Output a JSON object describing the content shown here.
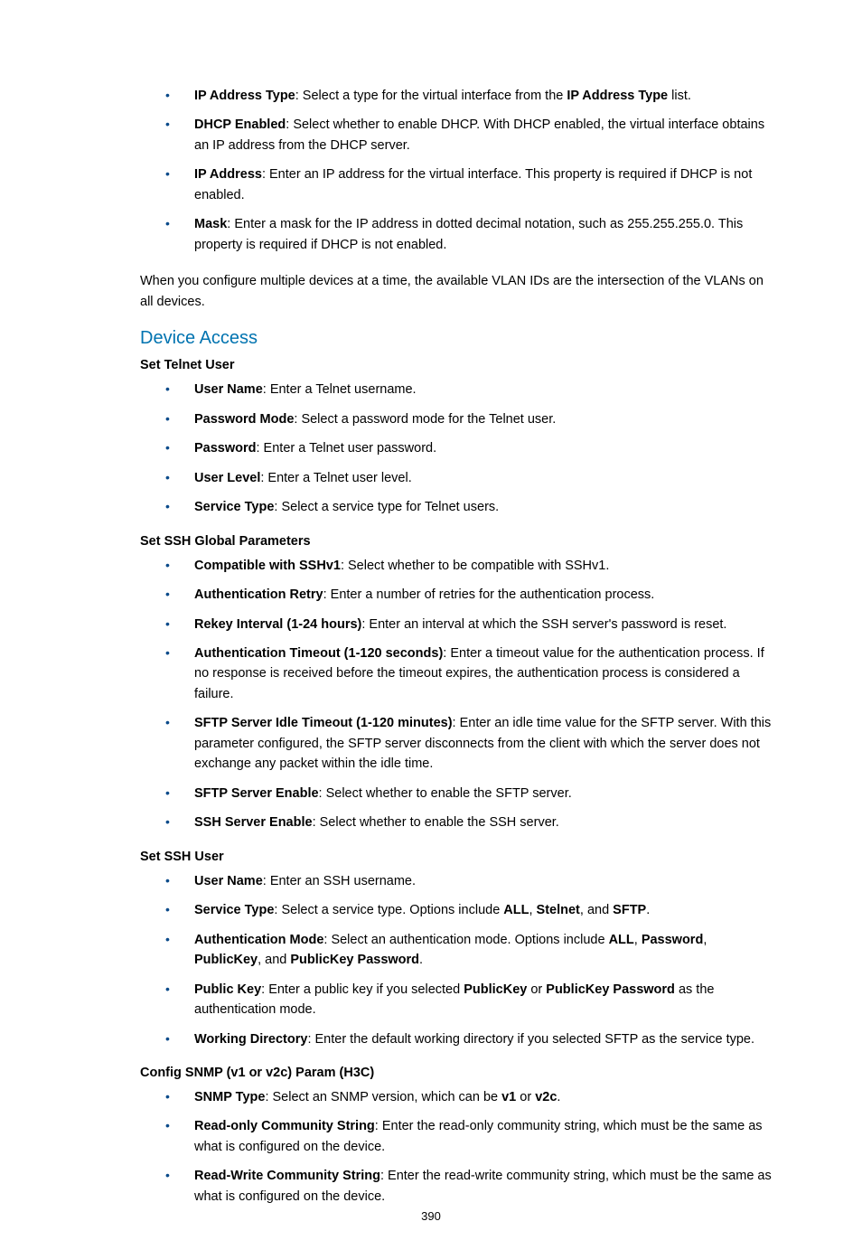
{
  "top_list": [
    {
      "bold": "IP Address Type",
      "rest": ": Select a type for the virtual interface from the ",
      "bold2": "IP Address Type",
      "rest2": " list."
    },
    {
      "bold": "DHCP Enabled",
      "rest": ": Select whether to enable DHCP. With DHCP enabled, the virtual interface obtains an IP address from the DHCP server."
    },
    {
      "bold": "IP Address",
      "rest": ": Enter an IP address for the virtual interface. This property is required if DHCP is not enabled."
    },
    {
      "bold": "Mask",
      "rest": ": Enter a mask for the IP address in dotted decimal notation, such as 255.255.255.0. This property is required if DHCP is not enabled."
    }
  ],
  "vlan_note": "When you configure multiple devices at a time, the available VLAN IDs are the intersection of the VLANs on all devices.",
  "heading_device_access": "Device Access",
  "telnet": {
    "title": "Set Telnet User",
    "items": [
      {
        "bold": "User Name",
        "rest": ": Enter a Telnet username."
      },
      {
        "bold": "Password Mode",
        "rest": ": Select a password mode for the Telnet user."
      },
      {
        "bold": "Password",
        "rest": ": Enter a Telnet user password."
      },
      {
        "bold": "User Level",
        "rest": ": Enter a Telnet user level."
      },
      {
        "bold": "Service Type",
        "rest": ": Select a service type for Telnet users."
      }
    ]
  },
  "ssh_global": {
    "title": "Set SSH Global Parameters",
    "items": [
      {
        "bold": "Compatible with SSHv1",
        "rest": ": Select whether to be compatible with SSHv1."
      },
      {
        "bold": "Authentication Retry",
        "rest": ": Enter a number of retries for the authentication process."
      },
      {
        "bold": "Rekey Interval (1-24 hours)",
        "rest": ": Enter an interval at which the SSH server's password is reset."
      },
      {
        "bold": "Authentication Timeout (1-120 seconds)",
        "rest": ": Enter a timeout value for the authentication process. If no response is received before the timeout expires, the authentication process is considered a failure."
      },
      {
        "bold": "SFTP Server Idle Timeout (1-120 minutes)",
        "rest": ": Enter an idle time value for the SFTP server. With this parameter configured, the SFTP server disconnects from the client with which the server does not exchange any packet within the idle time."
      },
      {
        "bold": "SFTP Server Enable",
        "rest": ": Select whether to enable the SFTP server."
      },
      {
        "bold": "SSH Server Enable",
        "rest": ": Select whether to enable the SSH server."
      }
    ]
  },
  "ssh_user": {
    "title": "Set SSH User",
    "items": [
      {
        "bold": "User Name",
        "rest": ": Enter an SSH username."
      },
      {
        "bold": "Service Type",
        "pre": ": Select a service type. Options include ",
        "b1": "ALL",
        "s1": ", ",
        "b2": "Stelnet",
        "s2": ", and ",
        "b3": "SFTP",
        "post": "."
      },
      {
        "bold": "Authentication Mode",
        "pre": ": Select an authentication mode. Options include ",
        "b1": "ALL",
        "s1": ", ",
        "b2": "Password",
        "s2": ", ",
        "b3": "PublicKey",
        "s3": ", and ",
        "b4": "PublicKey Password",
        "post": "."
      },
      {
        "bold": "Public Key",
        "pre": ": Enter a public key if you selected ",
        "b1": "PublicKey",
        "s1": " or ",
        "b2": "PublicKey Password",
        "post": " as the authentication mode."
      },
      {
        "bold": "Working Directory",
        "rest": ": Enter the default working directory if you selected SFTP as the service type."
      }
    ]
  },
  "snmp": {
    "title": "Config SNMP (v1 or v2c) Param (H3C)",
    "items": [
      {
        "bold": "SNMP Type",
        "pre": ": Select an SNMP version, which can be ",
        "b1": "v1",
        "s1": " or ",
        "b2": "v2c",
        "post": "."
      },
      {
        "bold": "Read-only Community String",
        "rest": ": Enter the read-only community string, which must be the same as what is configured on the device."
      },
      {
        "bold": "Read-Write Community String",
        "rest": ": Enter the read-write community string, which must be the same as what is configured on the device."
      }
    ]
  },
  "page_number": "390"
}
